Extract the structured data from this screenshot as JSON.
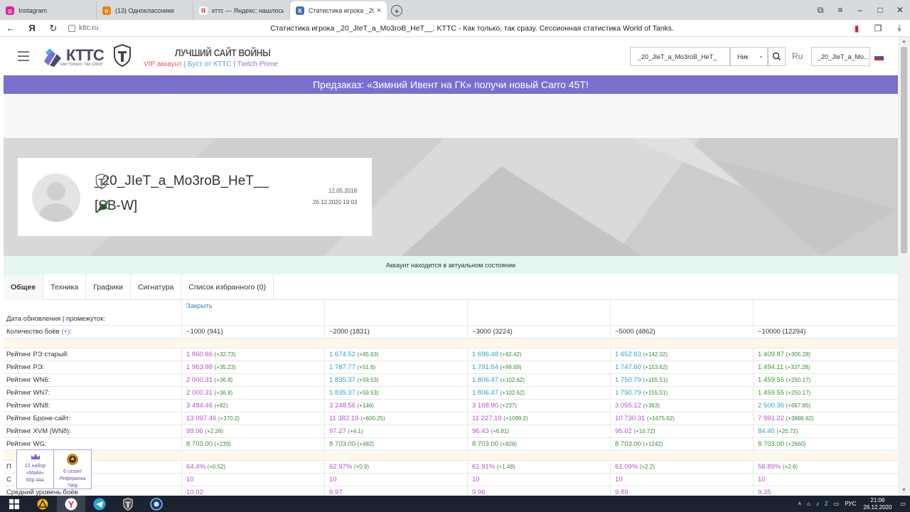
{
  "browser": {
    "tabs": [
      {
        "label": "Instagram",
        "color": "#d6249f",
        "glyph": "◎"
      },
      {
        "label": "(13) Одноклассники",
        "color": "#ee8208",
        "glyph": "ok"
      },
      {
        "label": "кттс — Яндекс: нашлось 5",
        "color": "#ff0000",
        "glyph": "Я"
      },
      {
        "label": "Статистика игрока _20_",
        "color": "#4a6fa5",
        "glyph": "К"
      }
    ],
    "url": "kttc.ru",
    "page_title": "Статистика игрока _20_JIeT_a_Mo3roB_HeT__. KTTC - Как только, так сразу. Сессионная статистика World of Tanks."
  },
  "header": {
    "logo_text": "КТТС",
    "logo_sub": "КАК ТОЛЬКО, ТАК СРАЗУ",
    "slogan": "ЛУЧШИЙ САЙТ ВОЙНЫ",
    "vip_link": "VIP аккаунт",
    "boost_link": "Буст от КТТС",
    "twitch_link": "Twitch Prime",
    "search_value": "_20_JIeT_a_Mo3roB_HeT_",
    "search_type": "Ник",
    "lang": "Ru",
    "user_value": "_20_JIeT_a_Mo..."
  },
  "banner": {
    "text": "Предзаказ: «Зимний Ивент на ГК» получи новый Carro 45T!"
  },
  "profile": {
    "nick": "_20_JIeT_a_Mo3roB_HeT__",
    "clan": "[SB-W]",
    "created": "12.05.2018",
    "updated": "26.12.2020 19:03"
  },
  "status": {
    "text": "Аккаунт находится в актуальном состоянии"
  },
  "page_tabs": [
    "Общее",
    "Техника",
    "Графики",
    "Сигнатура",
    "Список избранного (0)"
  ],
  "table": {
    "close_label": "Закрыть",
    "date_label": "Дата обновления | промежуток:",
    "battles_label": "Количество боёв",
    "battles_plus": "(+)",
    "battles_colon": ":",
    "columns": [
      "~1000 (941)",
      "~2000 (1831)",
      "~3000 (3224)",
      "~5000 (4862)",
      "~10000 (12294)"
    ],
    "rows": [
      {
        "label": "Рейтинг РЭ старый:",
        "cells": [
          [
            "1 860.66",
            "(+32.73)",
            "violet"
          ],
          [
            "1 674.52",
            "(+45.63)",
            "cyan"
          ],
          [
            "1 696.48",
            "(+92.42)",
            "cyan"
          ],
          [
            "1 652.63",
            "(+142.02)",
            "cyan"
          ],
          [
            "1 409.87",
            "(+305.28)",
            "green"
          ]
        ]
      },
      {
        "label": "Рейтинг РЭ:",
        "cells": [
          [
            "1 963.98",
            "(+35.23)",
            "violet"
          ],
          [
            "1 787.77",
            "(+51.6)",
            "cyan"
          ],
          [
            "1 791.54",
            "(+99.69)",
            "cyan"
          ],
          [
            "1 747.60",
            "(+153.62)",
            "cyan"
          ],
          [
            "1 494.11",
            "(+337.28)",
            "green"
          ]
        ]
      },
      {
        "label": "Рейтинг WN6:",
        "cells": [
          [
            "2 000.31",
            "(+36.8)",
            "violet"
          ],
          [
            "1 835.37",
            "(+59.53)",
            "cyan"
          ],
          [
            "1 806.47",
            "(+102.62)",
            "cyan"
          ],
          [
            "1 750.79",
            "(+155.51)",
            "cyan"
          ],
          [
            "1 459.55",
            "(+250.17)",
            "green"
          ]
        ]
      },
      {
        "label": "Рейтинг WN7:",
        "cells": [
          [
            "2 000.31",
            "(+36.8)",
            "violet"
          ],
          [
            "1 835.37",
            "(+59.53)",
            "cyan"
          ],
          [
            "1 806.47",
            "(+102.62)",
            "cyan"
          ],
          [
            "1 750.79",
            "(+155.51)",
            "cyan"
          ],
          [
            "1 459.55",
            "(+250.17)",
            "green"
          ]
        ]
      },
      {
        "label": "Рейтинг WN8:",
        "cells": [
          [
            "3 484.46",
            "(+82)",
            "violet"
          ],
          [
            "3 248.56",
            "(+146)",
            "violet"
          ],
          [
            "3 168.90",
            "(+237)",
            "violet"
          ],
          [
            "3 055.12",
            "(+363)",
            "violet"
          ],
          [
            "2 500.36",
            "(+667.85)",
            "cyan"
          ]
        ]
      },
      {
        "label": "Рейтинг Броне-сайт:",
        "cells": [
          [
            "13 097.46",
            "(+370.2)",
            "violet"
          ],
          [
            "11 382.19",
            "(+600.25)",
            "violet"
          ],
          [
            "11 227.19",
            "(+1099.2)",
            "violet"
          ],
          [
            "10 730.31",
            "(+1675.62)",
            "violet"
          ],
          [
            "7 991.22",
            "(+3886.62)",
            "violet"
          ]
        ]
      },
      {
        "label": "Рейтинг XVM (WN8):",
        "cells": [
          [
            "99.06",
            "(+2.26)",
            "violet"
          ],
          [
            "97.27",
            "(+4.1)",
            "violet"
          ],
          [
            "96.43",
            "(+6.81)",
            "violet"
          ],
          [
            "95.02",
            "(+10.72)",
            "violet"
          ],
          [
            "84.40",
            "(+20.72)",
            "cyan"
          ]
        ]
      },
      {
        "label": "Рейтинг WG:",
        "cells": [
          [
            "8 703.00",
            "(+239)",
            "green"
          ],
          [
            "8 703.00",
            "(+482)",
            "green"
          ],
          [
            "8 703.00",
            "(+826)",
            "green"
          ],
          [
            "8 703.00",
            "(+1242)",
            "green"
          ],
          [
            "8 703.00",
            "(+2660)",
            "green"
          ]
        ]
      }
    ],
    "rows2": [
      {
        "label": "П",
        "cells": [
          [
            "64.4%",
            "(+0.52)",
            "violet"
          ],
          [
            "62.97%",
            "(+0.9)",
            "violet"
          ],
          [
            "61.91%",
            "(+1.48)",
            "violet"
          ],
          [
            "61.09%",
            "(+2.2)",
            "violet"
          ],
          [
            "56.89%",
            "(+2.6)",
            "violet"
          ]
        ]
      },
      {
        "label": "С",
        "cells": [
          [
            "10",
            "",
            "violet"
          ],
          [
            "10",
            "",
            "violet"
          ],
          [
            "10",
            "",
            "violet"
          ],
          [
            "10",
            "",
            "violet"
          ],
          [
            "10",
            "",
            "violet"
          ]
        ]
      },
      {
        "label": "Средний уровень боёв",
        "cells": [
          [
            "10.02",
            "",
            "violet"
          ],
          [
            "9.97",
            "",
            "violet"
          ],
          [
            "9.96",
            "",
            "violet"
          ],
          [
            "9.89",
            "",
            "violet"
          ],
          [
            "9.35",
            "",
            "violet"
          ]
        ]
      }
    ]
  },
  "promo": {
    "left": {
      "l1": "22 набор",
      "l2": "«Майя»",
      "price": "65р",
      "old_price": "85р"
    },
    "right": {
      "l1": "6 сезон!",
      "l2": "Рефералка",
      "price": "790р"
    }
  },
  "taskbar": {
    "lang": "РУС",
    "time": "21:06",
    "date": "26.12.2020"
  }
}
